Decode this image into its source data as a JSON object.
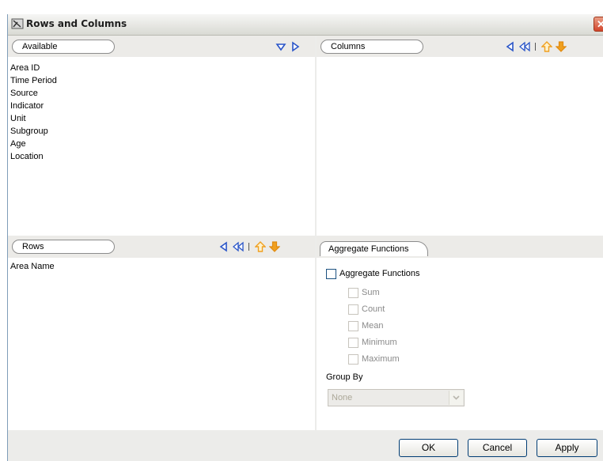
{
  "window": {
    "title": "Rows and Columns",
    "close_glyph": "✕"
  },
  "available": {
    "label": "Available",
    "items": [
      "Area ID",
      "Time Period",
      "Source",
      "Indicator",
      "Unit",
      "Subgroup",
      "Age",
      "Location"
    ]
  },
  "columns": {
    "label": "Columns",
    "items": []
  },
  "rows": {
    "label": "Rows",
    "items": [
      "Area Name"
    ]
  },
  "aggregate": {
    "tab_label": "Aggregate Functions",
    "checkbox_label": "Aggregate Functions",
    "functions": [
      "Sum",
      "Count",
      "Mean",
      "Minimum",
      "Maximum"
    ],
    "group_by_label": "Group By",
    "group_by_value": "None"
  },
  "buttons": {
    "ok": "OK",
    "cancel": "Cancel",
    "apply": "Apply"
  },
  "colors": {
    "arrow_blue": "#2a55c8",
    "arrow_orange": "#f0a020",
    "dialog_bg": "#ecebe8"
  }
}
